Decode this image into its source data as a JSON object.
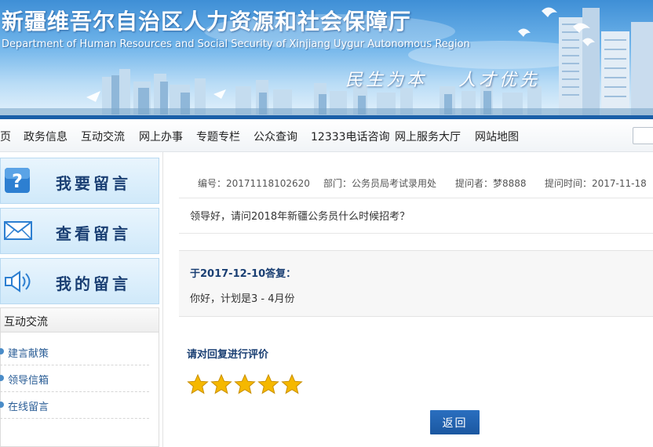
{
  "header": {
    "title": "新疆维吾尔自治区人力资源和社会保障厅",
    "subtitle": "Department of Human Resources and Social Security of Xinjiang Uygur Autonomous Region",
    "slogan_left": "民生为本",
    "slogan_right": "人才优先",
    "colors": {
      "sky_top": "#3f8fd6",
      "banner_strip": "#1a5fa8"
    }
  },
  "nav": {
    "items": [
      {
        "label": "页"
      },
      {
        "label": "政务信息"
      },
      {
        "label": "互动交流"
      },
      {
        "label": "网上办事"
      },
      {
        "label": "专题专栏"
      },
      {
        "label": "公众查询"
      },
      {
        "label": "12333电话咨询"
      },
      {
        "label": "网上服务大厅"
      },
      {
        "label": "网站地图"
      }
    ]
  },
  "sidebar": {
    "buttons": [
      {
        "label": "我要留言",
        "icon": "question-icon"
      },
      {
        "label": "查看留言",
        "icon": "envelope-icon"
      },
      {
        "label": "我的留言",
        "icon": "speaker-icon"
      }
    ],
    "panel_title": "互动交流",
    "links": [
      {
        "label": "建言献策"
      },
      {
        "label": "领导信箱"
      },
      {
        "label": "在线留言"
      }
    ]
  },
  "message": {
    "id_text": "编号：20171118102620",
    "dept_text": "部门：公务员局考试录用处",
    "asker_text": "提问者：梦8888",
    "time_text": "提问时间：2017-11-18",
    "question": "领导好，请问2018年新疆公务员什么时候招考？"
  },
  "reply": {
    "head": "于2017-12-10答复：",
    "text": "你好，计划是3 - 4月份"
  },
  "rating": {
    "label": "请对回复进行评价",
    "stars_total": 5,
    "stars_filled": 5,
    "star_color": "#f5b800"
  },
  "actions": {
    "back_label": "返回",
    "accent": "#1b57a0"
  }
}
